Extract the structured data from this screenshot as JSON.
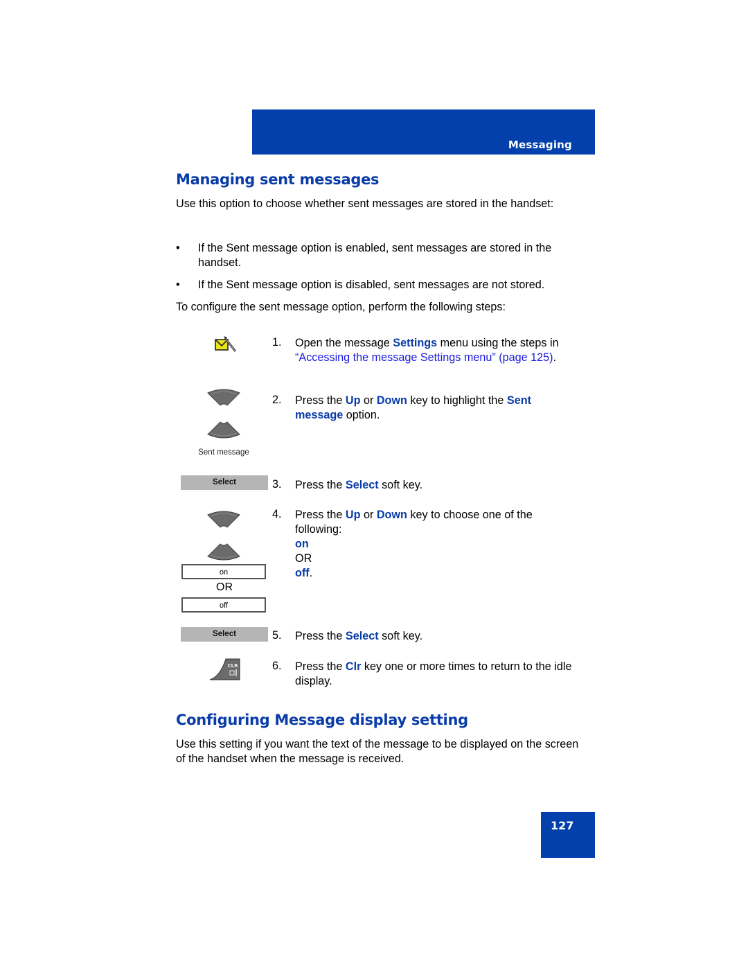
{
  "header": {
    "section_label": "Messaging",
    "band_color": "#0340ab"
  },
  "section1": {
    "title": "Managing sent messages",
    "intro": "Use this option to choose whether sent messages are stored in the handset:",
    "bullets": [
      "If the Sent message option is enabled, sent messages are stored in the handset.",
      "If the Sent message option is disabled, sent messages are not stored."
    ],
    "bullet_glyph": "•",
    "lead": "To configure the sent message option, perform the following steps:",
    "steps": [
      {
        "num": "1.",
        "pre": "Open the message ",
        "kw1": "Settings",
        "mid": " menu using the steps in ",
        "link": "“Accessing the message Settings menu” (page 125)",
        "post": "."
      },
      {
        "num": "2.",
        "pre": "Press the ",
        "kw1": "Up",
        "mid": " or ",
        "kw2": "Down",
        "mid2": " key to highlight the ",
        "kw3": "Sent message",
        "post": " option."
      },
      {
        "num": "3.",
        "pre": "Press the ",
        "kw1": "Select",
        "post": " soft key."
      },
      {
        "num": "4.",
        "pre": "Press the ",
        "kw1": "Up",
        "mid": " or ",
        "kw2": "Down",
        "mid2": " key to choose one of the following:",
        "opt1": "on",
        "or": "OR",
        "opt2": "off",
        "post": "."
      },
      {
        "num": "5.",
        "pre": "Press the ",
        "kw1": "Select",
        "post": " soft key."
      },
      {
        "num": "6.",
        "pre": "Press the ",
        "kw1": "Clr",
        "post": " key one or more times to return to the idle display."
      }
    ],
    "graphics": {
      "sent_message_caption": "Sent message",
      "softkey_label": "Select",
      "option_on": "on",
      "option_or": "OR",
      "option_off": "off",
      "clr_key_label": "CLR"
    }
  },
  "section2": {
    "title": "Configuring Message display setting",
    "intro": "Use this setting if you want the text of the message to be displayed on the screen of the handset when the message is received."
  },
  "footer": {
    "page_number": "127"
  }
}
